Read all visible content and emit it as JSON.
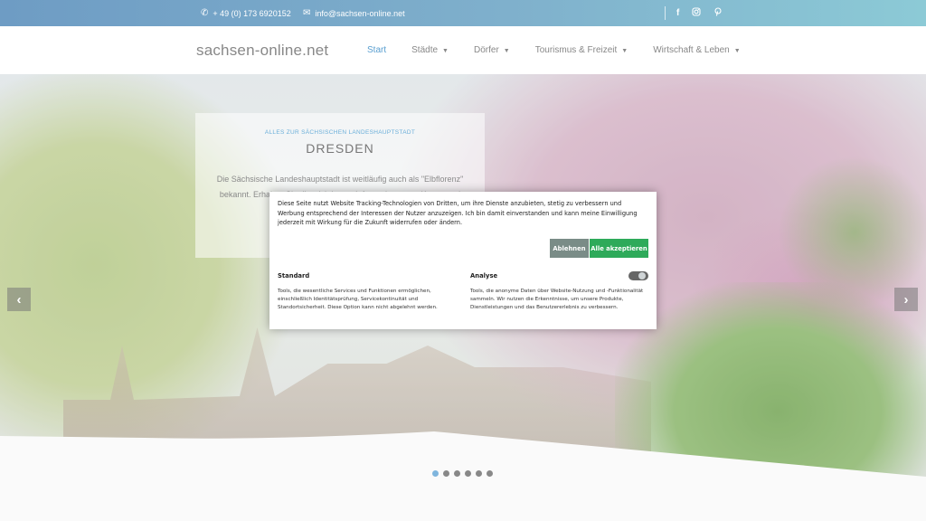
{
  "topbar": {
    "phone": "+ 49 (0) 173 6920152",
    "email": "info@sachsen-online.net",
    "phone_icon": "phone-icon",
    "email_icon": "envelope-icon",
    "social": [
      "f",
      "instagram",
      "pinterest"
    ]
  },
  "header": {
    "logo": "sachsen-online.net",
    "nav": [
      {
        "label": "Start",
        "active": true
      },
      {
        "label": "Städte"
      },
      {
        "label": "Dörfer"
      },
      {
        "label": "Tourismus & Freizeit"
      },
      {
        "label": "Wirtschaft & Leben"
      }
    ]
  },
  "slide": {
    "kicker": "ALLES ZUR SÄCHSISCHEN LANDESHAUPTSTADT",
    "title": "DRESDEN",
    "body": "Die Sächsische Landeshauptstadt ist weitläufig auch als \"Elbflorenz\" bekannt. Erhalten Sie die wichtigsten Informationen zur Kunst- und"
  },
  "carousel": {
    "prev": "‹",
    "next": "›",
    "dots": 6,
    "active_dot": 0
  },
  "cookie": {
    "text": "Diese Seite nutzt Website Tracking-Technologien von Dritten, um ihre Dienste anzubieten, stetig zu verbessern und Werbung entsprechend der Interessen der Nutzer anzuzeigen. Ich bin damit einverstanden und kann meine Einwilligung jederzeit mit Wirkung für die Zukunft widerrufen oder ändern.",
    "reject": "Ablehnen",
    "accept": "Alle akzeptieren",
    "standard_title": "Standard",
    "standard_desc": "Tools, die wesentliche Services und Funktionen ermöglichen, einschließlich Identitätsprüfung, Servicekontinuität und Standortsicherheit. Diese Option kann nicht abgelehnt werden.",
    "analyse_title": "Analyse",
    "analyse_desc": "Tools, die anonyme Daten über Website-Nutzung und -Funktionalität sammeln. Wir nutzen die Erkenntnisse, um unsere Produkte, Dienstleistungen und das Benutzererlebnis zu verbessern.",
    "analyse_enabled": false
  },
  "colors": {
    "accent": "#5a9fd0",
    "accept_button": "#2eaa5a",
    "reject_button": "#7a8c87"
  }
}
